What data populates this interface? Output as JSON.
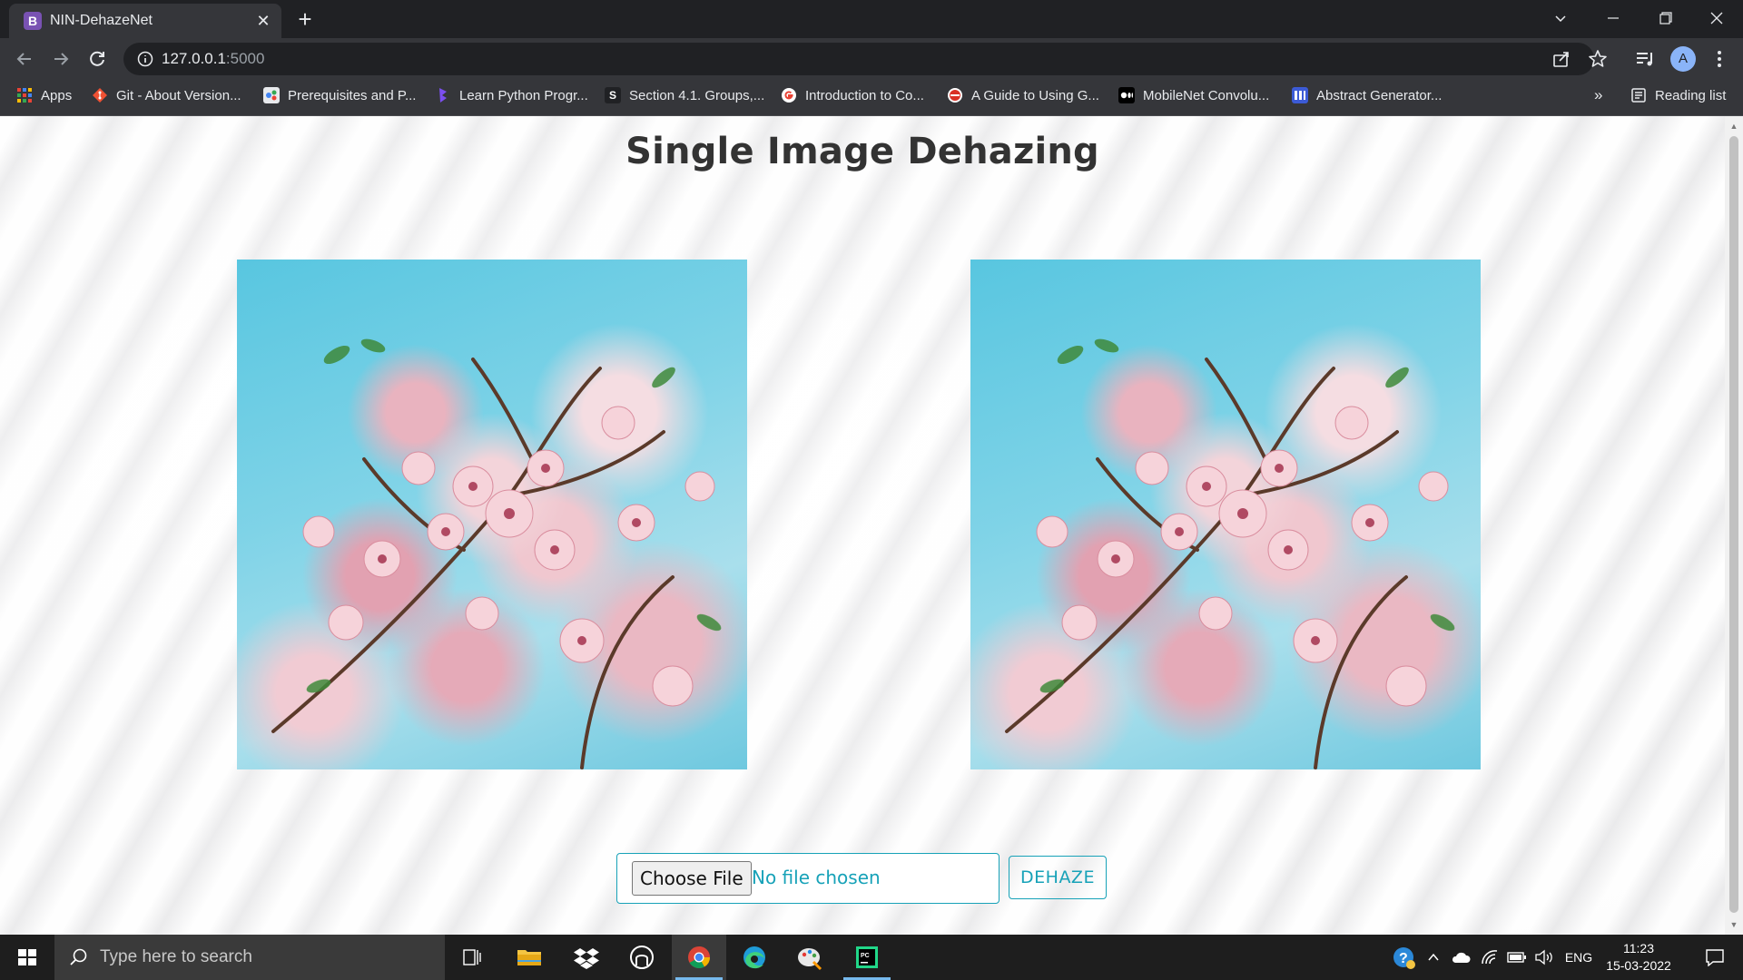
{
  "browser": {
    "tab": {
      "favicon_letter": "B",
      "title": "NIN-DehazeNet"
    },
    "address": {
      "host": "127.0.0.1",
      "port": ":5000"
    },
    "profile_initial": "A"
  },
  "bookmarks": {
    "items": [
      {
        "label": "Apps",
        "icon": "apps-grid-icon",
        "color": "#4285f4"
      },
      {
        "label": "Git - About Version...",
        "icon": "git-icon",
        "color": "#f05133"
      },
      {
        "label": "Prerequisites and P...",
        "icon": "site-icon",
        "color": "#e8eaed"
      },
      {
        "label": "Learn Python Progr...",
        "icon": "programiz-icon",
        "color": "#7b4ff0"
      },
      {
        "label": "Section 4.1. Groups,...",
        "icon": "s-icon",
        "color": "#202124"
      },
      {
        "label": "Introduction to Co...",
        "icon": "google-icon",
        "color": "#ffffff"
      },
      {
        "label": "A Guide to Using G...",
        "icon": "site-icon",
        "color": "#d93025"
      },
      {
        "label": "MobileNet Convolu...",
        "icon": "medium-icon",
        "color": "#000000"
      },
      {
        "label": "Abstract Generator...",
        "icon": "site-icon",
        "color": "#3c5bd6"
      }
    ],
    "more": "»",
    "reading_list": "Reading list"
  },
  "page": {
    "title": "Single Image Dehazing",
    "file_input": {
      "button_label": "Choose File",
      "status": "No file chosen"
    },
    "submit_label": "DEHAZE"
  },
  "taskbar": {
    "search_placeholder": "Type here to search",
    "language": "ENG",
    "time": "11:23",
    "date": "15-03-2022"
  }
}
